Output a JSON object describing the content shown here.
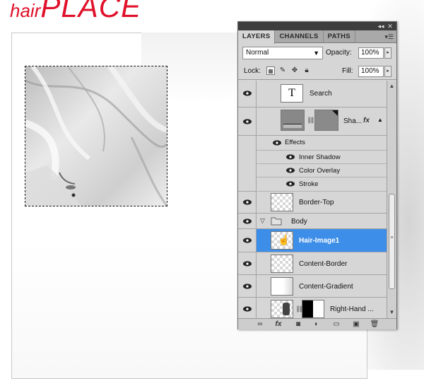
{
  "canvas": {
    "logo_small": "hair",
    "logo_large": "PLACE"
  },
  "panel": {
    "tabs": [
      {
        "label": "LAYERS",
        "active": true
      },
      {
        "label": "CHANNELS",
        "active": false
      },
      {
        "label": "PATHS",
        "active": false
      }
    ],
    "blend_mode": "Normal",
    "opacity_label": "Opacity:",
    "opacity_value": "100%",
    "lock_label": "Lock:",
    "fill_label": "Fill:",
    "fill_value": "100%"
  },
  "layers": {
    "search": {
      "name": "Search",
      "thumb_glyph": "T"
    },
    "shape": {
      "name": "Sha..."
    },
    "effects_label": "Effects",
    "effects": [
      "Inner Shadow",
      "Color Overlay",
      "Stroke"
    ],
    "border_top": {
      "name": "Border-Top"
    },
    "body_group": {
      "name": "Body"
    },
    "hair_image": {
      "name": "Hair-Image1",
      "selected": true
    },
    "content_border": {
      "name": "Content-Border"
    },
    "content_gradient": {
      "name": "Content-Gradient"
    },
    "right_hand": {
      "name": "Right-Hand ..."
    }
  },
  "colors": {
    "logo_red": "#e0102a",
    "selection_blue": "#3d8ee9",
    "panel_gray": "#d6d6d6"
  }
}
